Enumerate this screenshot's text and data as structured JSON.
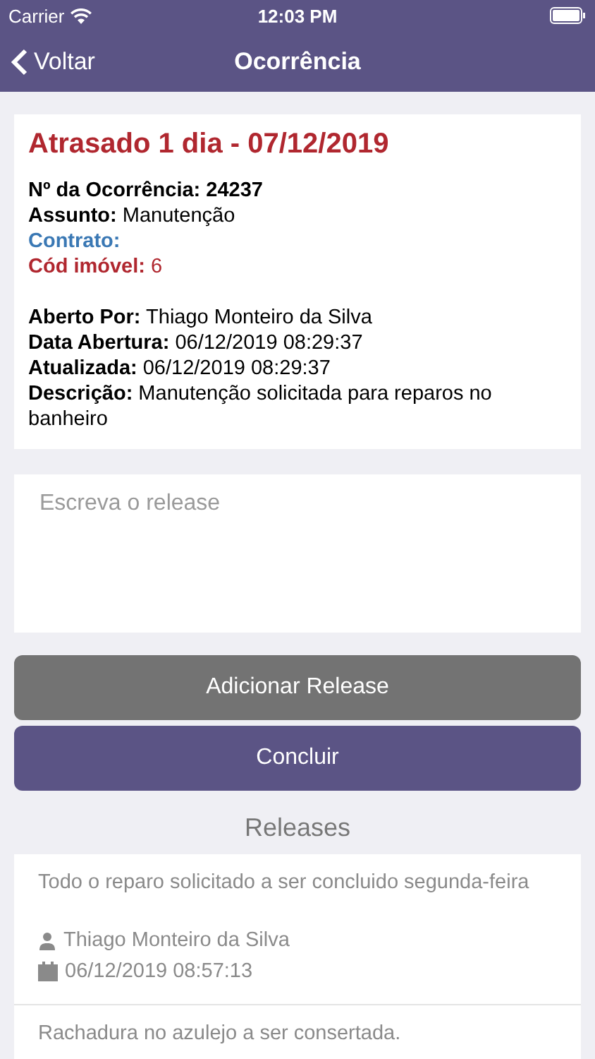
{
  "status_bar": {
    "carrier": "Carrier",
    "time": "12:03 PM"
  },
  "nav": {
    "back": "Voltar",
    "title": "Ocorrência"
  },
  "card": {
    "headline": "Atrasado 1 dia - 07/12/2019",
    "groups": [
      [
        {
          "kind": "heading",
          "label": "Nº da Ocorrência:",
          "value": "24237",
          "color": "#000000"
        },
        {
          "kind": "pair",
          "label": "Assunto:",
          "value": "Manutenção",
          "color": "#000000"
        },
        {
          "kind": "pair",
          "label": "Contrato:",
          "color": "#3a78b4"
        },
        {
          "kind": "pair",
          "label": "Cód imóvel:",
          "value": "6",
          "color": "#b0272f"
        }
      ],
      [
        {
          "kind": "pair",
          "label": "Aberto Por:",
          "value": "Thiago Monteiro da Silva",
          "color": "#000000"
        },
        {
          "kind": "pair",
          "label": "Data Abertura:",
          "value": "06/12/2019 08:29:37",
          "color": "#000000"
        },
        {
          "kind": "pair",
          "label": "Atualizada:",
          "value": "06/12/2019 08:29:37",
          "color": "#000000"
        },
        {
          "kind": "pair",
          "label": "Descrição:",
          "value": "Manutenção solicitada para reparos no banheiro",
          "color": "#000000"
        }
      ]
    ]
  },
  "release_input": {
    "placeholder": "Escreva o release"
  },
  "buttons": [
    {
      "kind": "secondary",
      "label": "Adicionar Release"
    },
    {
      "kind": "primary",
      "label": "Concluir"
    }
  ],
  "releases": {
    "title": "Releases",
    "items": [
      {
        "text": "Todo o reparo solicitado a ser concluido segunda-feira",
        "author": "Thiago Monteiro da Silva",
        "date": "06/12/2019 08:57:13"
      },
      {
        "text": "Rachadura no azulejo a ser consertada."
      }
    ]
  }
}
